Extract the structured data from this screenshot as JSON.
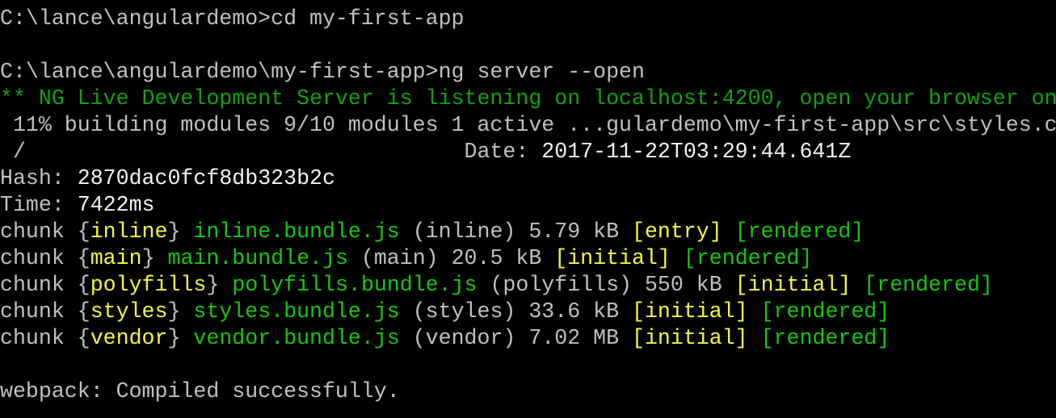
{
  "colors": {
    "gray": "#c0c0c0",
    "white": "#f2f2f2",
    "dgreen": "#13a10e",
    "green": "#16c60c",
    "yellow": "#f5f543",
    "background": "#000000"
  },
  "lines": [
    [
      {
        "t": "C:\\lance\\angulardemo>cd my-first-app",
        "c": "gray"
      }
    ],
    [],
    [
      {
        "t": "C:\\lance\\angulardemo\\my-first-app>ng server --open",
        "c": "gray"
      }
    ],
    [
      {
        "t": "** NG Live Development Server is listening on localhost:4200, open your browser on",
        "c": "dgreen"
      }
    ],
    [
      {
        "t": " 11% building modules 9/10 modules 1 active ...gulardemo\\my-first-app\\src\\styles.c",
        "c": "gray"
      }
    ],
    [
      {
        "t": " /                                  Date: ",
        "c": "gray"
      },
      {
        "t": "2017-11-22T03:29:44.641Z",
        "c": "white"
      }
    ],
    [
      {
        "t": "Hash: ",
        "c": "gray"
      },
      {
        "t": "2870dac0fcf8db323b2c",
        "c": "white"
      }
    ],
    [
      {
        "t": "Time: ",
        "c": "gray"
      },
      {
        "t": "7422ms",
        "c": "white"
      }
    ],
    [
      {
        "t": "chunk {",
        "c": "gray"
      },
      {
        "t": "inline",
        "c": "yellow"
      },
      {
        "t": "} ",
        "c": "gray"
      },
      {
        "t": "inline.bundle.js",
        "c": "green"
      },
      {
        "t": " (inline) 5.79 kB ",
        "c": "gray"
      },
      {
        "t": "[entry]",
        "c": "yellow"
      },
      {
        "t": " ",
        "c": "gray"
      },
      {
        "t": "[rendered]",
        "c": "green"
      }
    ],
    [
      {
        "t": "chunk {",
        "c": "gray"
      },
      {
        "t": "main",
        "c": "yellow"
      },
      {
        "t": "} ",
        "c": "gray"
      },
      {
        "t": "main.bundle.js",
        "c": "green"
      },
      {
        "t": " (main) 20.5 kB ",
        "c": "gray"
      },
      {
        "t": "[initial]",
        "c": "yellow"
      },
      {
        "t": " ",
        "c": "gray"
      },
      {
        "t": "[rendered]",
        "c": "green"
      }
    ],
    [
      {
        "t": "chunk {",
        "c": "gray"
      },
      {
        "t": "polyfills",
        "c": "yellow"
      },
      {
        "t": "} ",
        "c": "gray"
      },
      {
        "t": "polyfills.bundle.js",
        "c": "green"
      },
      {
        "t": " (polyfills) 550 kB ",
        "c": "gray"
      },
      {
        "t": "[initial]",
        "c": "yellow"
      },
      {
        "t": " ",
        "c": "gray"
      },
      {
        "t": "[rendered]",
        "c": "green"
      }
    ],
    [
      {
        "t": "chunk {",
        "c": "gray"
      },
      {
        "t": "styles",
        "c": "yellow"
      },
      {
        "t": "} ",
        "c": "gray"
      },
      {
        "t": "styles.bundle.js",
        "c": "green"
      },
      {
        "t": " (styles) 33.6 kB ",
        "c": "gray"
      },
      {
        "t": "[initial]",
        "c": "yellow"
      },
      {
        "t": " ",
        "c": "gray"
      },
      {
        "t": "[rendered]",
        "c": "green"
      }
    ],
    [
      {
        "t": "chunk {",
        "c": "gray"
      },
      {
        "t": "vendor",
        "c": "yellow"
      },
      {
        "t": "} ",
        "c": "gray"
      },
      {
        "t": "vendor.bundle.js",
        "c": "green"
      },
      {
        "t": " (vendor) 7.02 MB ",
        "c": "gray"
      },
      {
        "t": "[initial]",
        "c": "yellow"
      },
      {
        "t": " ",
        "c": "gray"
      },
      {
        "t": "[rendered]",
        "c": "green"
      }
    ],
    [],
    [
      {
        "t": "webpack: Compiled successfully.",
        "c": "gray"
      }
    ]
  ]
}
